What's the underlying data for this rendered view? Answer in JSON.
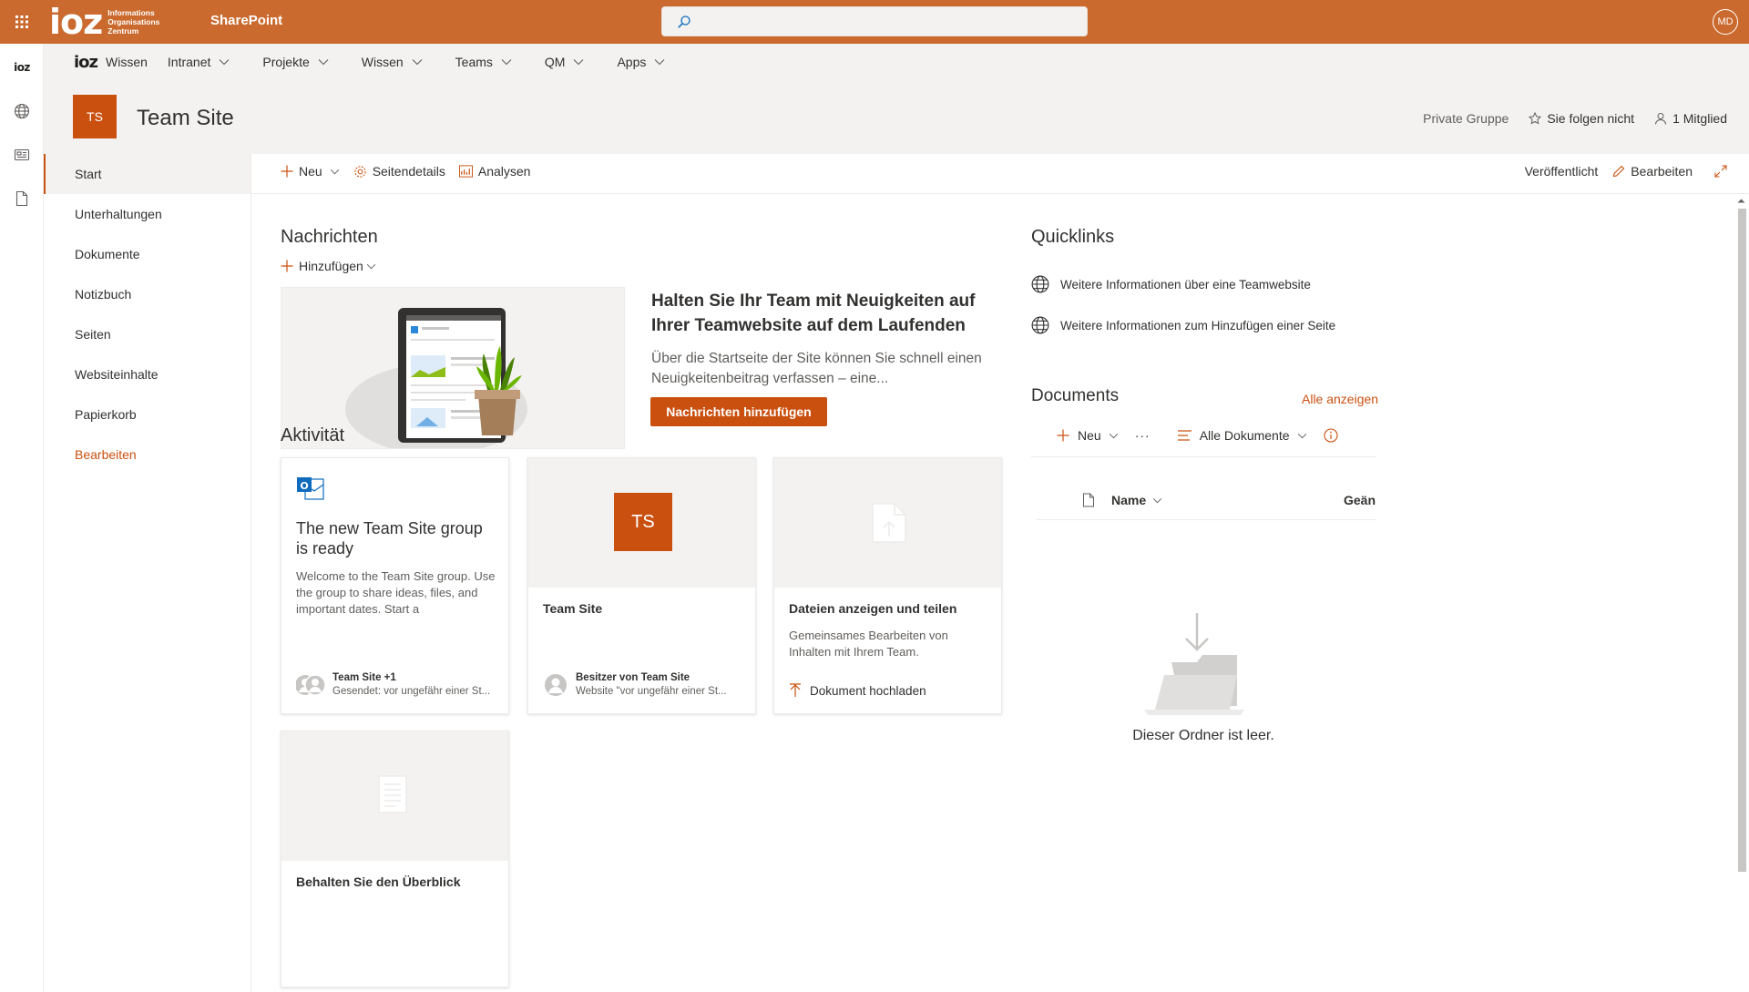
{
  "suite": {
    "brand_logo": "ioz",
    "brand_sub": [
      "Informations",
      "Organisations",
      "Zentrum"
    ],
    "app_name": "SharePoint",
    "search_placeholder": "",
    "user_initials": "MD",
    "color": "#ca6a2e"
  },
  "appbar": {
    "logo": "ioz",
    "icons": [
      "globe-icon",
      "news-icon",
      "document-icon"
    ]
  },
  "hubnav": {
    "logo": "ioz",
    "home_label": "Wissen",
    "items": [
      "Intranet",
      "Projekte",
      "Wissen",
      "Teams",
      "QM",
      "Apps"
    ]
  },
  "site": {
    "logo_initials": "TS",
    "title": "Team Site",
    "group_type": "Private Gruppe",
    "follow_label": "Sie folgen nicht",
    "members_label": "1 Mitglied",
    "accent": "#ca5010"
  },
  "leftnav": {
    "items": [
      "Start",
      "Unterhaltungen",
      "Dokumente",
      "Notizbuch",
      "Seiten",
      "Websiteinhalte",
      "Papierkorb"
    ],
    "edit_label": "Bearbeiten",
    "active_index": 0
  },
  "commandbar": {
    "new_label": "Neu",
    "details_label": "Seitendetails",
    "analytics_label": "Analysen",
    "status_label": "Veröffentlicht",
    "edit_label": "Bearbeiten"
  },
  "news": {
    "title": "Nachrichten",
    "add_label": "Hinzufügen",
    "headline": "Halten Sie Ihr Team mit Neuigkeiten auf Ihrer Teamwebsite auf dem Laufenden",
    "description": "Über die Startseite der Site können Sie schnell einen Neuigkeitenbeitrag verfassen – eine...",
    "button_label": "Nachrichten hinzufügen"
  },
  "activity": {
    "title": "Aktivität",
    "cards": [
      {
        "title": "The new Team Site group is ready",
        "text": "Welcome to the Team Site group. Use the group to share ideas, files, and important dates. Start a",
        "author": "Team Site +1",
        "meta": "Gesendet: vor ungefähr einer St..."
      },
      {
        "initials": "TS",
        "title": "Team Site",
        "author": "Besitzer von Team Site",
        "meta": "Website \"vor ungefähr einer St..."
      },
      {
        "title": "Dateien anzeigen und teilen",
        "text": "Gemeinsames Bearbeiten von Inhalten mit Ihrem Team.",
        "action": "Dokument hochladen"
      },
      {
        "title": "Behalten Sie den Überblick"
      }
    ]
  },
  "quicklinks": {
    "title": "Quicklinks",
    "items": [
      "Weitere Informationen über eine Teamwebsite",
      "Weitere Informationen zum Hinzufügen einer Seite"
    ]
  },
  "documents": {
    "title": "Documents",
    "see_all": "Alle anzeigen",
    "new_label": "Neu",
    "more_label": "···",
    "view_label": "Alle Dokumente",
    "col_name": "Name",
    "col_modified": "Geän",
    "empty_text": "Dieser Ordner ist leer."
  }
}
